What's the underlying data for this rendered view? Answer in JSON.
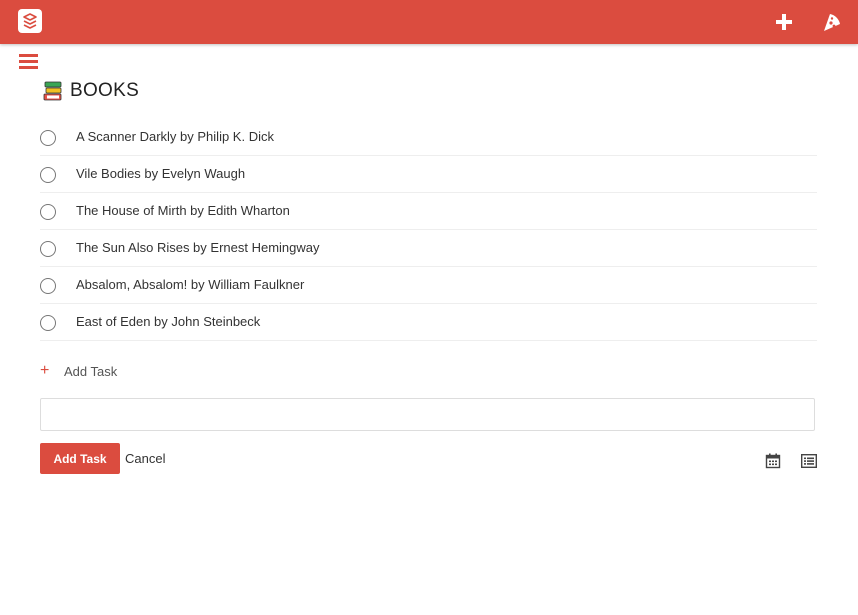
{
  "topbar": {
    "color": "#db4c3f",
    "logo_icon": "todoist-logo-icon",
    "add_icon": "plus-icon",
    "karma_icon": "pizza-slice-icon"
  },
  "menu": {
    "icon": "hamburger-menu-icon"
  },
  "project": {
    "icon": "books-emoji-icon",
    "title": "BOOKS"
  },
  "tasks": [
    {
      "text": "A Scanner Darkly by Philip K. Dick"
    },
    {
      "text": "Vile Bodies by Evelyn Waugh"
    },
    {
      "text": "The House of Mirth by Edith Wharton"
    },
    {
      "text": "The Sun Also Rises by Ernest Hemingway"
    },
    {
      "text": "Absalom, Absalom! by William Faulkner"
    },
    {
      "text": "East of Eden by John Steinbeck"
    }
  ],
  "add_task": {
    "plus": "+",
    "label": "Add Task"
  },
  "editor": {
    "input_value": "",
    "submit_label": "Add Task",
    "cancel_label": "Cancel",
    "schedule_icon": "calendar-icon",
    "project_icon": "list-icon"
  }
}
